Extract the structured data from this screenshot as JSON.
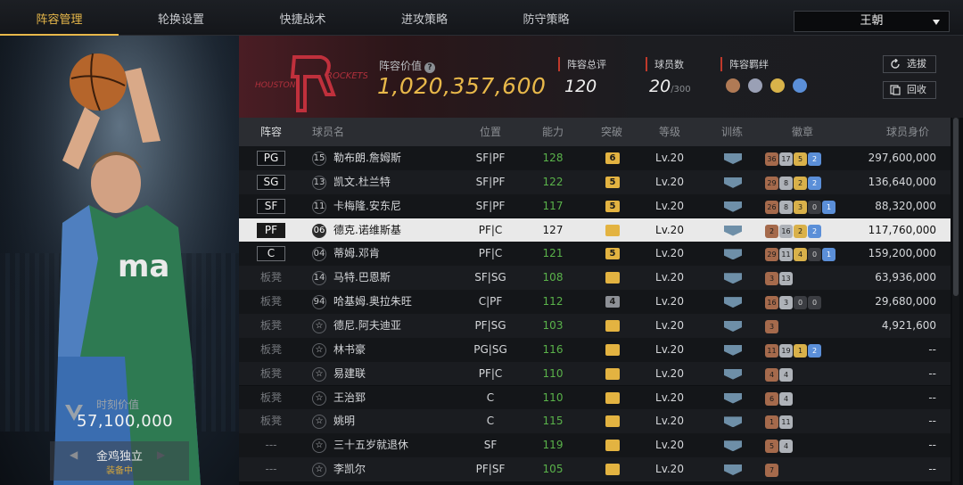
{
  "nav": {
    "tabs": [
      "阵容管理",
      "轮换设置",
      "快捷战术",
      "进攻策略",
      "防守策略"
    ],
    "team_select": "王朝"
  },
  "left_panel": {
    "moment_label": "时刻价值",
    "moment_value": "57,100,000",
    "skill_name": "金鸡独立",
    "skill_status": "装备中"
  },
  "header": {
    "value_label": "阵容价值",
    "value": "1,020,357,600",
    "rating_label": "阵容总评",
    "rating": "120",
    "players_label": "球员数",
    "players_count": "20",
    "players_max": "/300",
    "bond_label": "阵容羁绊",
    "btn_select": "选拔",
    "btn_recycle": "回收",
    "logo_text_left": "HOUSTON",
    "logo_text_right": "ROCKETS"
  },
  "table": {
    "headers": [
      "阵容",
      "球员名",
      "位置",
      "能力",
      "突破",
      "等级",
      "训练",
      "徽章",
      "球员身价"
    ],
    "rows": [
      {
        "slot": "PG",
        "num": "15",
        "name": "勒布朗.詹姆斯",
        "pos": "SF|PF",
        "ability": "128",
        "brk": "6",
        "level": "Lv.20",
        "badges": [
          [
            "b",
            "36"
          ],
          [
            "s",
            "17"
          ],
          [
            "g",
            "5"
          ],
          [
            "h",
            "2"
          ]
        ],
        "value": "297,600,000"
      },
      {
        "slot": "SG",
        "num": "13",
        "name": "凯文.杜兰特",
        "pos": "SF|PF",
        "ability": "122",
        "brk": "5",
        "level": "Lv.20",
        "badges": [
          [
            "b",
            "29"
          ],
          [
            "s",
            "8"
          ],
          [
            "g",
            "2"
          ],
          [
            "h",
            "2"
          ]
        ],
        "value": "136,640,000"
      },
      {
        "slot": "SF",
        "num": "11",
        "name": "卡梅隆.安东尼",
        "pos": "SF|PF",
        "ability": "117",
        "brk": "5",
        "level": "Lv.20",
        "badges": [
          [
            "b",
            "26"
          ],
          [
            "s",
            "8"
          ],
          [
            "g",
            "3"
          ],
          [
            "d",
            "0"
          ],
          [
            "h",
            "1"
          ]
        ],
        "value": "88,320,000"
      },
      {
        "slot": "PF",
        "num": "06",
        "name": "德克.诺维斯基",
        "pos": "PF|C",
        "ability": "127",
        "brk": "",
        "level": "Lv.20",
        "badges": [
          [
            "b",
            "2"
          ],
          [
            "s",
            "16"
          ],
          [
            "g",
            "2"
          ],
          [
            "h",
            "2"
          ]
        ],
        "value": "117,760,000"
      },
      {
        "slot": "C",
        "num": "04",
        "name": "蒂姆.邓肯",
        "pos": "PF|C",
        "ability": "121",
        "brk": "5",
        "level": "Lv.20",
        "badges": [
          [
            "b",
            "29"
          ],
          [
            "s",
            "11"
          ],
          [
            "g",
            "4"
          ],
          [
            "d",
            "0"
          ],
          [
            "h",
            "1"
          ]
        ],
        "value": "159,200,000"
      },
      {
        "slot": "板凳",
        "num": "14",
        "name": "马特.巴恩斯",
        "pos": "SF|SG",
        "ability": "108",
        "brk": "",
        "level": "Lv.20",
        "badges": [
          [
            "b",
            "3"
          ],
          [
            "s",
            "13"
          ]
        ],
        "value": "63,936,000"
      },
      {
        "slot": "板凳",
        "num": "94",
        "name": "哈基姆.奥拉朱旺",
        "pos": "C|PF",
        "ability": "112",
        "brk": "4",
        "level": "Lv.20",
        "badges": [
          [
            "b",
            "16"
          ],
          [
            "s",
            "3"
          ],
          [
            "d",
            "0"
          ],
          [
            "d",
            "0"
          ]
        ],
        "value": "29,680,000"
      },
      {
        "slot": "板凳",
        "num": "",
        "name": "德尼.阿夫迪亚",
        "pos": "PF|SG",
        "ability": "103",
        "brk": "",
        "level": "Lv.20",
        "badges": [
          [
            "b",
            "3"
          ]
        ],
        "value": "4,921,600"
      },
      {
        "slot": "板凳",
        "num": "",
        "name": "林书豪",
        "pos": "PG|SG",
        "ability": "116",
        "brk": "",
        "level": "Lv.20",
        "badges": [
          [
            "b",
            "11"
          ],
          [
            "s",
            "19"
          ],
          [
            "g",
            "1"
          ],
          [
            "h",
            "2"
          ]
        ],
        "value": "--"
      },
      {
        "slot": "板凳",
        "num": "",
        "name": "易建联",
        "pos": "PF|C",
        "ability": "110",
        "brk": "",
        "level": "Lv.20",
        "badges": [
          [
            "b",
            "4"
          ],
          [
            "s",
            "4"
          ]
        ],
        "value": "--"
      },
      {
        "slot": "板凳",
        "num": "",
        "name": "王治郅",
        "pos": "C",
        "ability": "110",
        "brk": "",
        "level": "Lv.20",
        "badges": [
          [
            "b",
            "6"
          ],
          [
            "s",
            "4"
          ]
        ],
        "value": "--"
      },
      {
        "slot": "板凳",
        "num": "",
        "name": "姚明",
        "pos": "C",
        "ability": "115",
        "brk": "",
        "level": "Lv.20",
        "badges": [
          [
            "b",
            "1"
          ],
          [
            "s",
            "11"
          ]
        ],
        "value": "--"
      },
      {
        "slot": "---",
        "num": "",
        "name": "三十五岁就退休",
        "pos": "SF",
        "ability": "119",
        "brk": "",
        "level": "Lv.20",
        "badges": [
          [
            "b",
            "5"
          ],
          [
            "s",
            "4"
          ]
        ],
        "value": "--"
      },
      {
        "slot": "---",
        "num": "",
        "name": "李凯尔",
        "pos": "PF|SF",
        "ability": "105",
        "brk": "",
        "level": "Lv.20",
        "badges": [
          [
            "b",
            "7"
          ]
        ],
        "value": "--"
      }
    ]
  }
}
